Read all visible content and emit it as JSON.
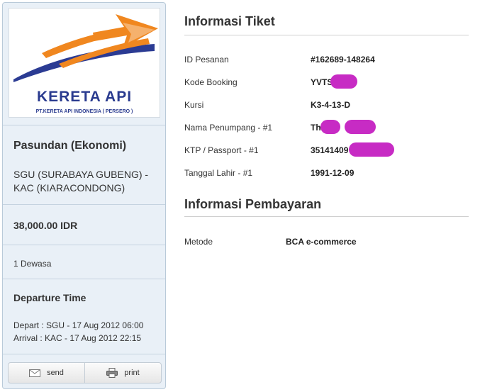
{
  "ticket_card": {
    "logo": {
      "title": "KERETA API",
      "subtitle": "PT.KERETA API INDONESIA ( PERSERO )",
      "colors": {
        "orange": "#f0871f",
        "blue": "#2b3b93"
      }
    },
    "train_name": "Pasundan (Ekonomi)",
    "route_line1": "SGU (SURABAYA GUBENG) -",
    "route_line2": "KAC (KIARACONDONG)",
    "price": "38,000.00 IDR",
    "passengers": "1 Dewasa",
    "departure_title": "Departure Time",
    "depart": "Depart : SGU - 17 Aug 2012 06:00",
    "arrival": "Arrival : KAC - 17 Aug 2012 22:15",
    "buttons": {
      "send": {
        "label": "send",
        "icon": "envelope-icon"
      },
      "print": {
        "label": "print",
        "icon": "printer-icon"
      }
    }
  },
  "ticket_info": {
    "title": "Informasi Tiket",
    "rows": [
      {
        "label": "ID Pesanan",
        "value": "#162689-148264"
      },
      {
        "label": "Kode Booking",
        "value": "YVTS"
      },
      {
        "label": "Kursi",
        "value": "K3-4-13-D"
      },
      {
        "label": "Nama Penumpang - #1",
        "value": "Th"
      },
      {
        "label": "KTP / Passport - #1",
        "value": "35141409"
      },
      {
        "label": "Tanggal Lahir - #1",
        "value": "1991-12-09"
      }
    ]
  },
  "payment_info": {
    "title": "Informasi Pembayaran",
    "method_label": "Metode",
    "method_value": "BCA e-commerce"
  },
  "redaction_color": "#c72bc4"
}
